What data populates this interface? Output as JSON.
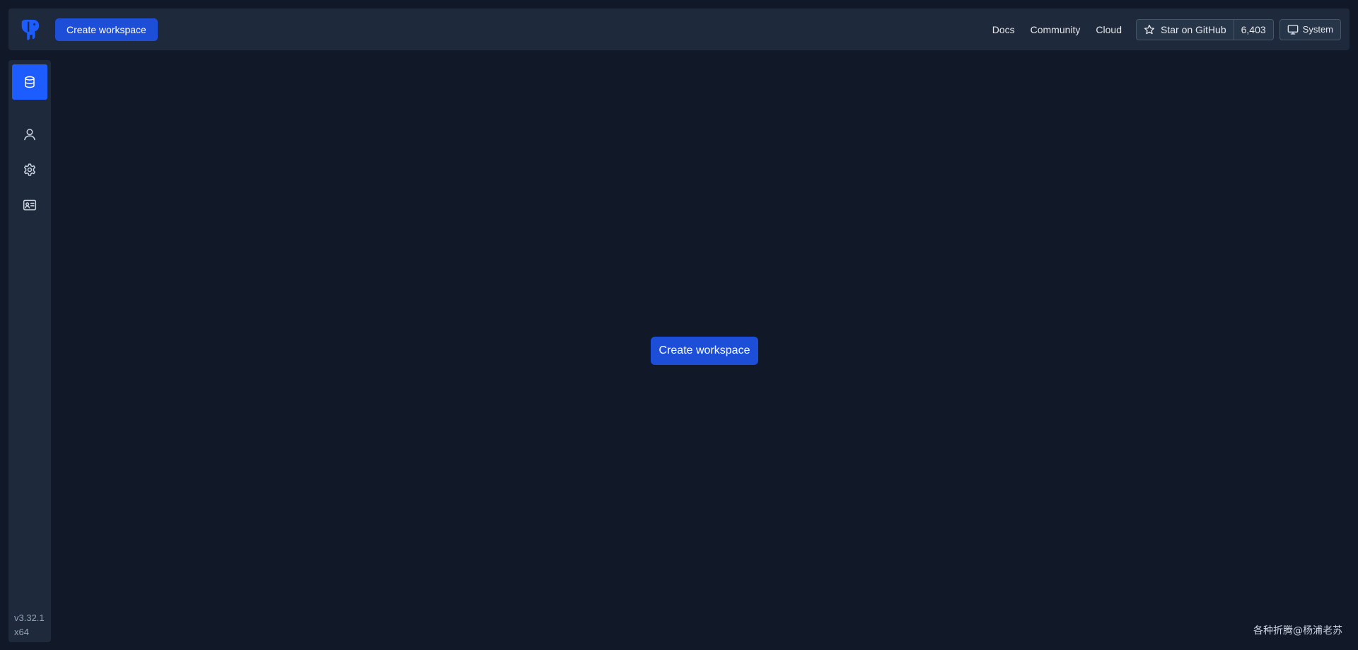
{
  "header": {
    "create_label": "Create workspace",
    "links": [
      "Docs",
      "Community",
      "Cloud"
    ],
    "github_star_label": "Star on GitHub",
    "github_count": "6,403",
    "system_label": "System"
  },
  "sidebar": {
    "items": [
      {
        "icon": "database-icon",
        "active": true
      },
      {
        "icon": "user-icon",
        "active": false
      },
      {
        "icon": "gear-icon",
        "active": false
      },
      {
        "icon": "id-card-icon",
        "active": false
      }
    ],
    "version": "v3.32.1",
    "arch": "x64"
  },
  "main": {
    "create_label": "Create workspace"
  },
  "watermark": "各种折腾@杨浦老苏",
  "colors": {
    "background": "#111827",
    "panel": "#1e293b",
    "primary": "#1d4ed8",
    "active": "#1d5cff"
  }
}
